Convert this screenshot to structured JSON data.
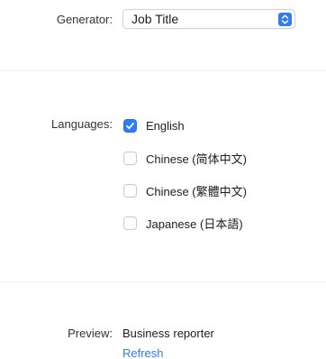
{
  "generator": {
    "label": "Generator:",
    "selected": "Job Title"
  },
  "languages": {
    "label": "Languages:",
    "options": [
      {
        "label": "English",
        "checked": true
      },
      {
        "label": "Chinese (简体中文)",
        "checked": false
      },
      {
        "label": "Chinese (繁體中文)",
        "checked": false
      },
      {
        "label": "Japanese (日本語)",
        "checked": false
      }
    ]
  },
  "preview": {
    "label": "Preview:",
    "value": "Business reporter",
    "refresh_label": "Refresh"
  },
  "colors": {
    "accent": "#2f7cf6"
  }
}
